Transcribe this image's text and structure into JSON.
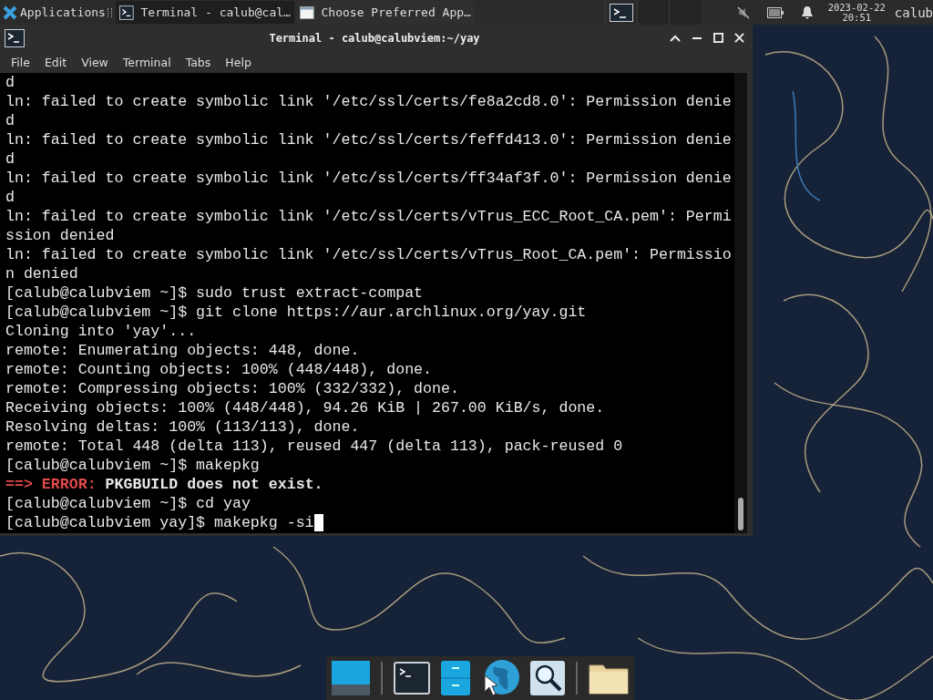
{
  "panel": {
    "applications": "Applications",
    "tasks": [
      {
        "title": "Terminal - calub@cal…",
        "kind": "terminal",
        "selected": true
      },
      {
        "title": "Choose Preferred App…",
        "kind": "dialog",
        "selected": false
      }
    ],
    "clock": {
      "date": "2023-02-22",
      "time": "20:51"
    },
    "user": "calub"
  },
  "window": {
    "title": "Terminal - calub@calubviem:~/yay",
    "menu": [
      "File",
      "Edit",
      "View",
      "Terminal",
      "Tabs",
      "Help"
    ]
  },
  "terminal": {
    "lines": [
      {
        "kind": "text",
        "text": "d"
      },
      {
        "kind": "text",
        "text": "ln: failed to create symbolic link '/etc/ssl/certs/fe8a2cd8.0': Permission denie"
      },
      {
        "kind": "text",
        "text": "d"
      },
      {
        "kind": "text",
        "text": "ln: failed to create symbolic link '/etc/ssl/certs/feffd413.0': Permission denie"
      },
      {
        "kind": "text",
        "text": "d"
      },
      {
        "kind": "text",
        "text": "ln: failed to create symbolic link '/etc/ssl/certs/ff34af3f.0': Permission denie"
      },
      {
        "kind": "text",
        "text": "d"
      },
      {
        "kind": "text",
        "text": "ln: failed to create symbolic link '/etc/ssl/certs/vTrus_ECC_Root_CA.pem': Permi"
      },
      {
        "kind": "text",
        "text": "ssion denied"
      },
      {
        "kind": "text",
        "text": "ln: failed to create symbolic link '/etc/ssl/certs/vTrus_Root_CA.pem': Permissio"
      },
      {
        "kind": "text",
        "text": "n denied"
      },
      {
        "kind": "text",
        "text": "[calub@calubviem ~]$ sudo trust extract-compat"
      },
      {
        "kind": "text",
        "text": "[calub@calubviem ~]$ git clone https://aur.archlinux.org/yay.git"
      },
      {
        "kind": "text",
        "text": "Cloning into 'yay'..."
      },
      {
        "kind": "text",
        "text": "remote: Enumerating objects: 448, done."
      },
      {
        "kind": "text",
        "text": "remote: Counting objects: 100% (448/448), done."
      },
      {
        "kind": "text",
        "text": "remote: Compressing objects: 100% (332/332), done."
      },
      {
        "kind": "text",
        "text": "Receiving objects: 100% (448/448), 94.26 KiB | 267.00 KiB/s, done."
      },
      {
        "kind": "text",
        "text": "Resolving deltas: 100% (113/113), done."
      },
      {
        "kind": "text",
        "text": "remote: Total 448 (delta 113), reused 447 (delta 113), pack-reused 0"
      },
      {
        "kind": "text",
        "text": "[calub@calubviem ~]$ makepkg"
      },
      {
        "kind": "error",
        "arrow": "==>",
        "label": "ERROR:",
        "message": "PKGBUILD does not exist."
      },
      {
        "kind": "text",
        "text": "[calub@calubviem ~]$ cd yay"
      },
      {
        "kind": "prompt",
        "text": "[calub@calubviem yay]$ makepkg -si"
      }
    ]
  }
}
